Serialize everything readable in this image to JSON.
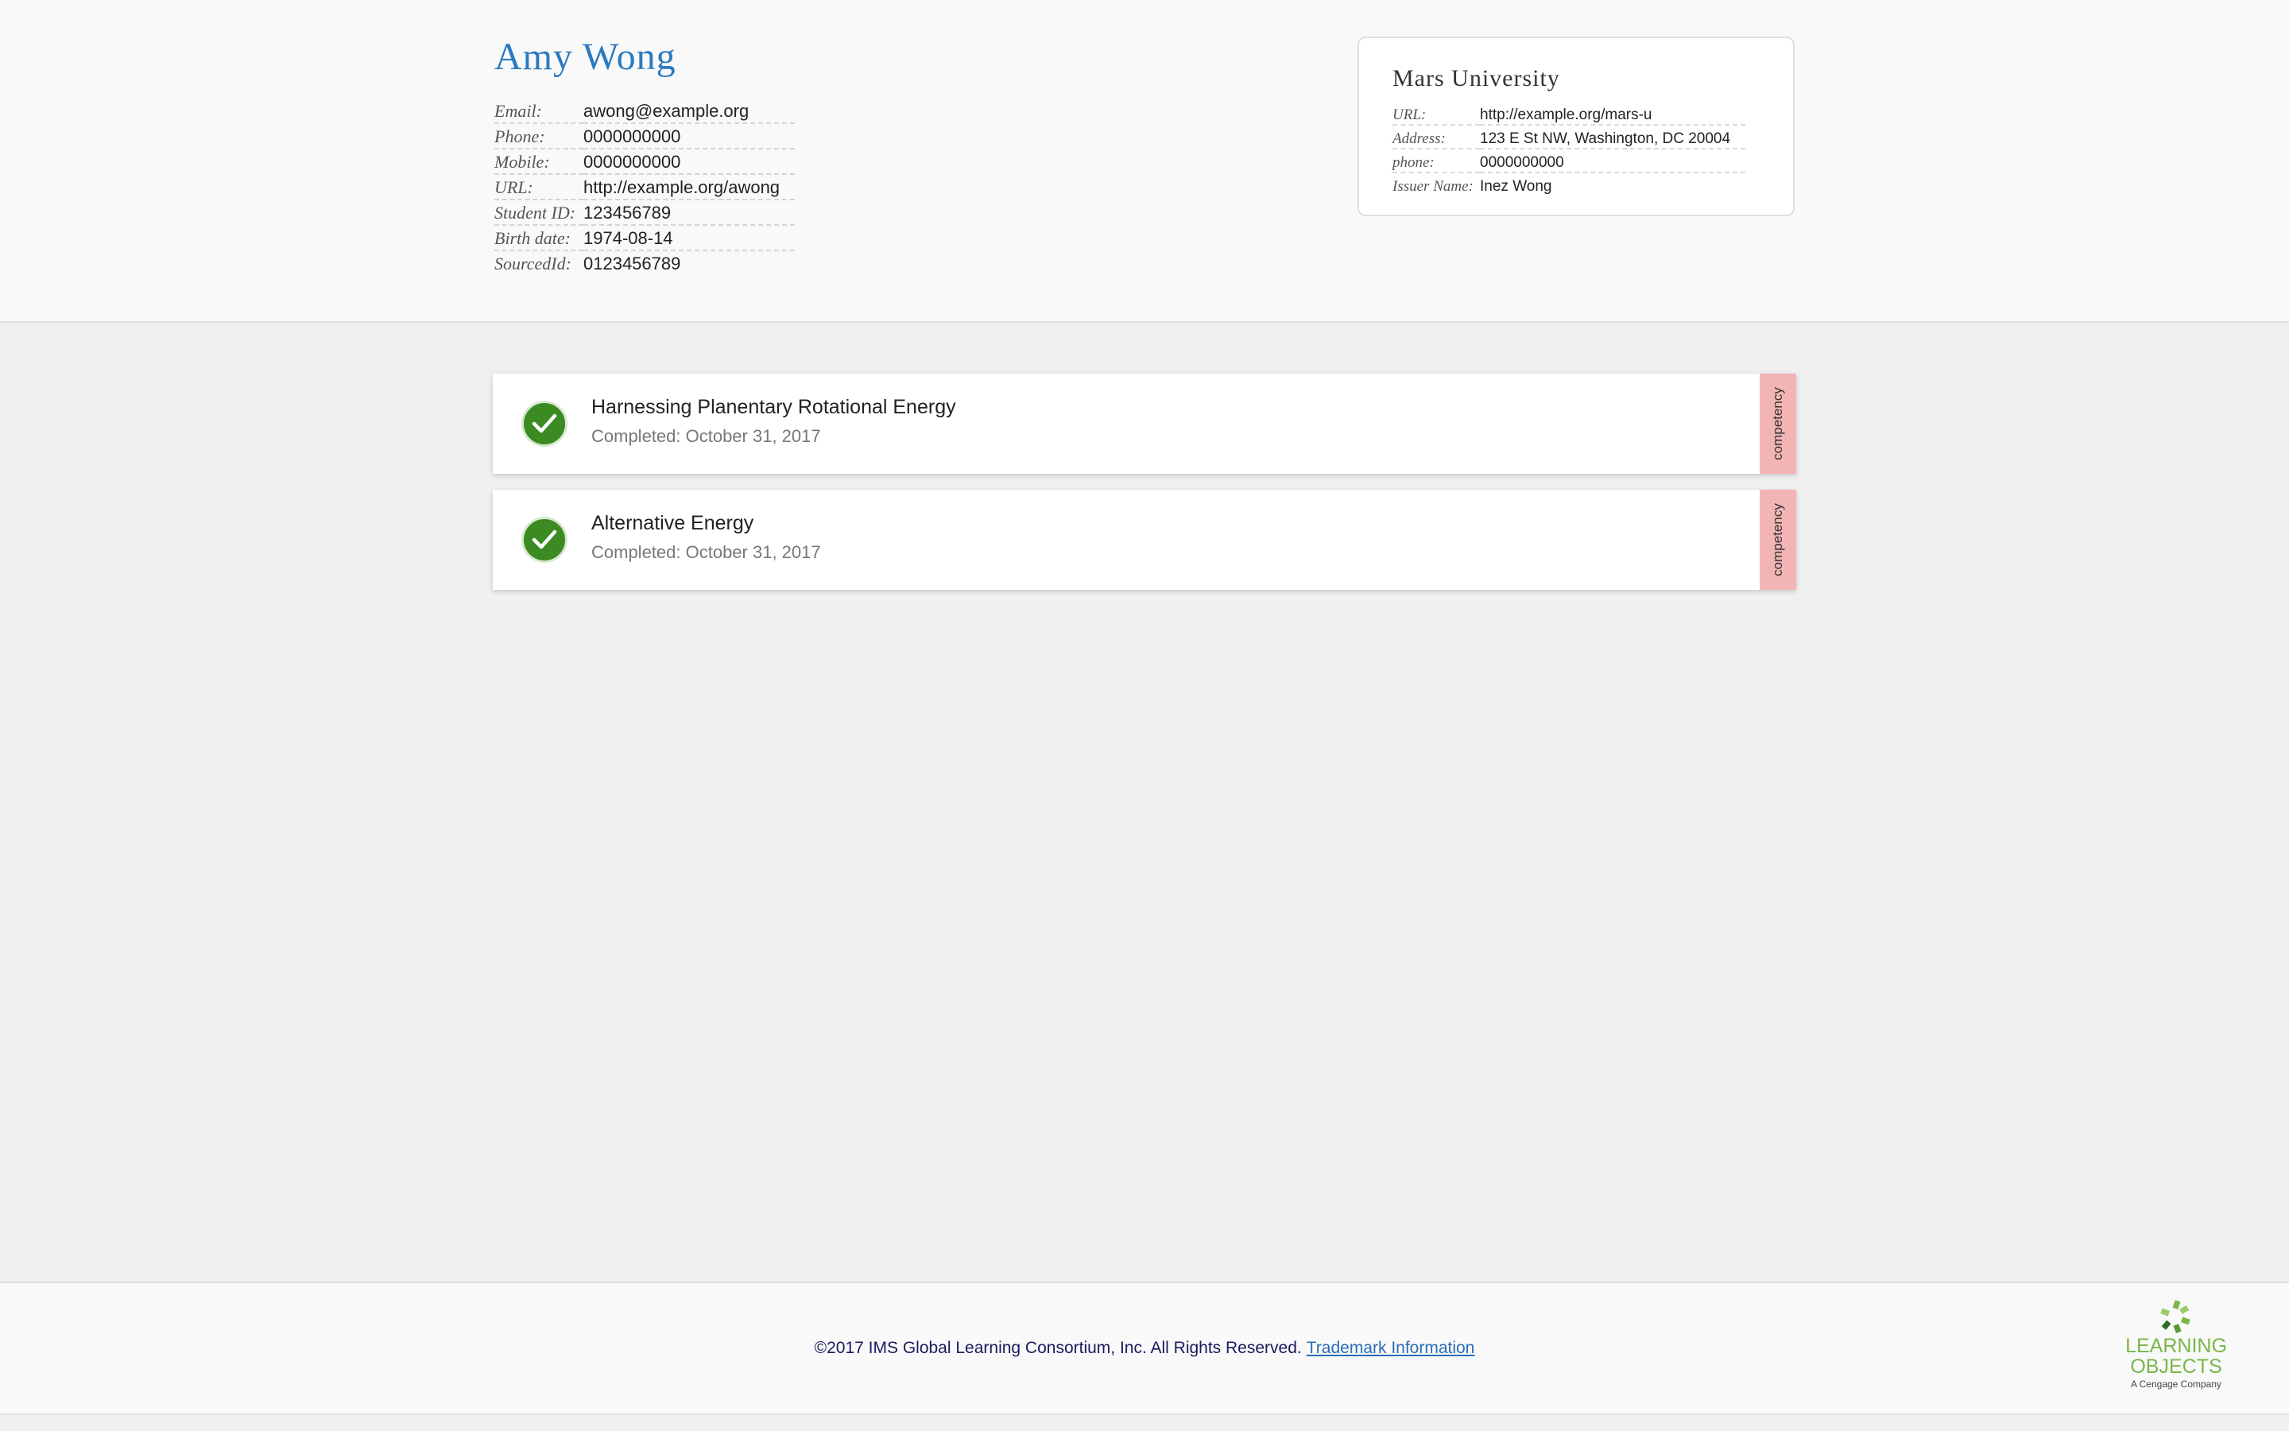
{
  "student": {
    "name": "Amy Wong",
    "fields": [
      {
        "label": "Email:",
        "value": "awong@example.org"
      },
      {
        "label": "Phone:",
        "value": "0000000000"
      },
      {
        "label": "Mobile:",
        "value": "0000000000"
      },
      {
        "label": "URL:",
        "value": "http://example.org/awong"
      },
      {
        "label": "Student ID:",
        "value": "123456789"
      },
      {
        "label": "Birth date:",
        "value": "1974-08-14"
      },
      {
        "label": "SourcedId:",
        "value": "0123456789"
      }
    ]
  },
  "issuer": {
    "name": "Mars University",
    "fields": [
      {
        "label": "URL:",
        "value": "http://example.org/mars-u"
      },
      {
        "label": "Address:",
        "value": "123 E St NW, Washington, DC 20004"
      },
      {
        "label": "phone:",
        "value": "0000000000"
      },
      {
        "label": "Issuer Name:",
        "value": "Inez Wong"
      }
    ]
  },
  "achievements": [
    {
      "title": "Harnessing Planentary Rotational Energy",
      "completed": "Completed: October 31, 2017",
      "type": "competency",
      "status_icon": "check-circle-icon"
    },
    {
      "title": "Alternative Energy",
      "completed": "Completed: October 31, 2017",
      "type": "competency",
      "status_icon": "check-circle-icon"
    }
  ],
  "footer": {
    "copyright": "©2017 IMS Global Learning Consortium, Inc. All Rights Reserved.",
    "trademark_link": "Trademark Information"
  },
  "logo": {
    "line1": "LEARNING",
    "line2": "OBJECTS",
    "sub": "A Cengage Company"
  },
  "colors": {
    "name_blue": "#2a7ac0",
    "check_green": "#3b8a22",
    "competency_tab": "#f2b4b4",
    "logo_green": "#7ab648",
    "link_blue": "#2a6cb8"
  }
}
